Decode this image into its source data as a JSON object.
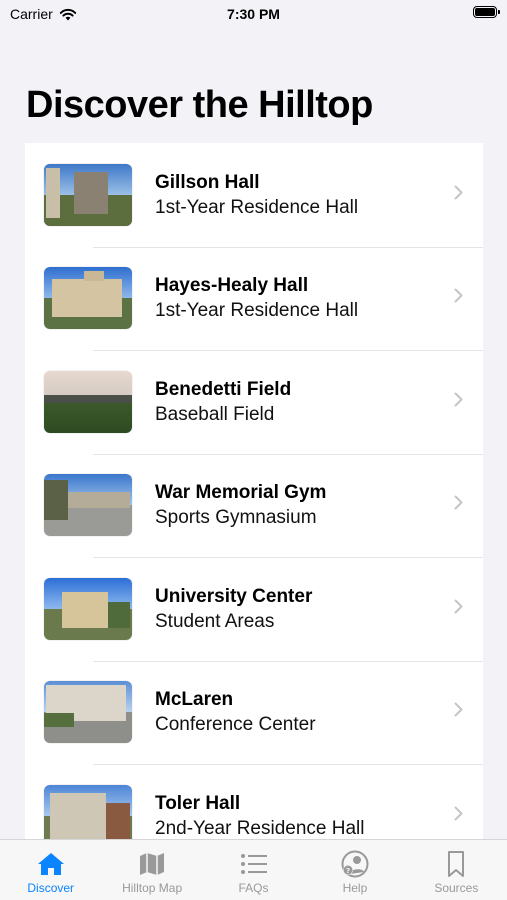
{
  "status_bar": {
    "carrier": "Carrier",
    "time": "7:30 PM"
  },
  "page": {
    "title": "Discover the Hilltop"
  },
  "locations": [
    {
      "name": "Gillson Hall",
      "subtitle": "1st-Year Residence Hall"
    },
    {
      "name": "Hayes-Healy Hall",
      "subtitle": "1st-Year Residence Hall"
    },
    {
      "name": "Benedetti Field",
      "subtitle": "Baseball Field"
    },
    {
      "name": "War Memorial Gym",
      "subtitle": "Sports Gymnasium"
    },
    {
      "name": "University Center",
      "subtitle": "Student Areas"
    },
    {
      "name": "McLaren",
      "subtitle": "Conference Center"
    },
    {
      "name": "Toler Hall",
      "subtitle": "2nd-Year Residence Hall"
    }
  ],
  "tabs": [
    {
      "label": "Discover",
      "icon": "house-icon",
      "active": true
    },
    {
      "label": "Hilltop Map",
      "icon": "map-icon",
      "active": false
    },
    {
      "label": "FAQs",
      "icon": "list-icon",
      "active": false
    },
    {
      "label": "Help",
      "icon": "help-person-icon",
      "active": false
    },
    {
      "label": "Sources",
      "icon": "bookmark-icon",
      "active": false
    }
  ],
  "colors": {
    "accent": "#0a84ff",
    "inactive_tab": "#999999",
    "background": "#f2f2f7"
  }
}
